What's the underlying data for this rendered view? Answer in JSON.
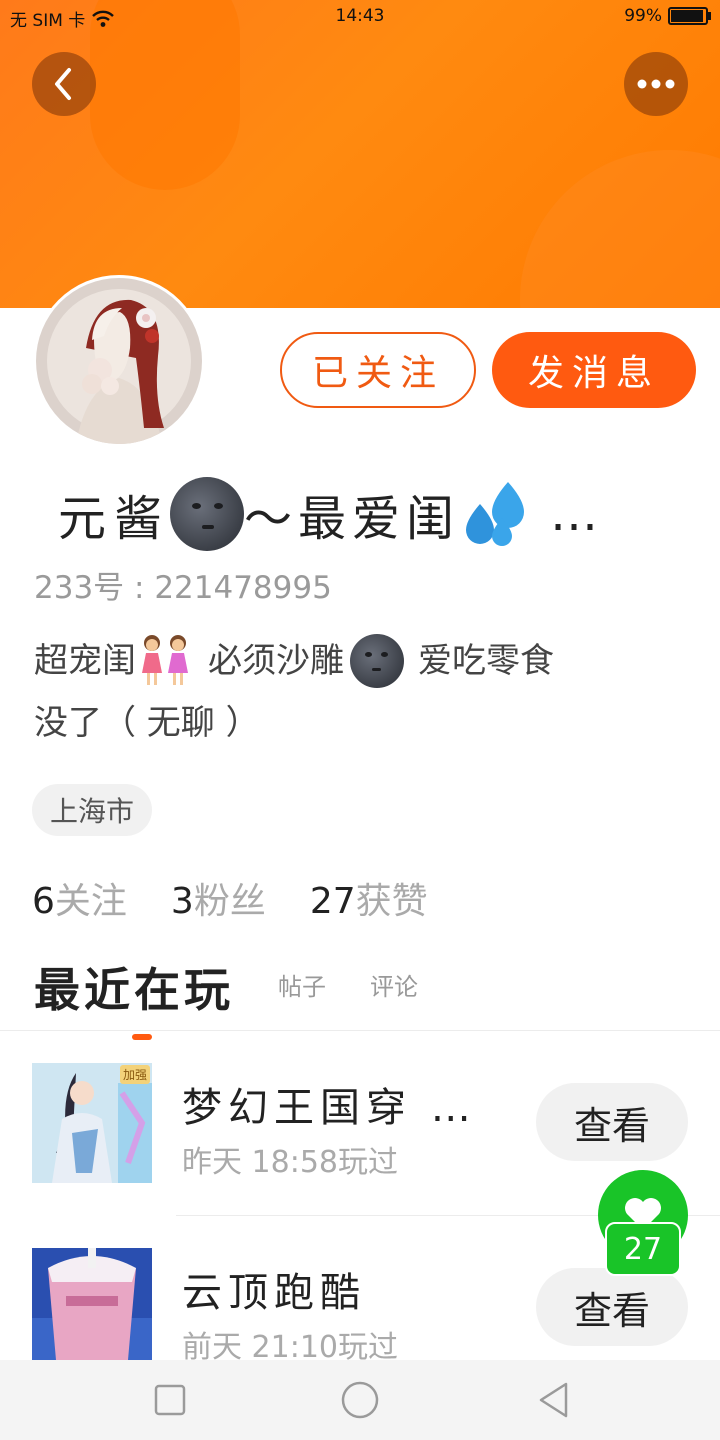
{
  "status_bar": {
    "carrier": "无 SIM 卡",
    "time": "14:43",
    "battery": "99%",
    "battery_level": 0.99
  },
  "header": {
    "back_icon": "chevron-left-icon",
    "more_icon": "more-horizontal-icon",
    "banner_color": "#ff7f12"
  },
  "profile": {
    "follow_button": "已关注",
    "message_button": "发消息",
    "name_prefix": "元酱",
    "name_middle": "～最爱闺",
    "name_suffix": "…",
    "uid": "233号 : 221478995",
    "bio_part1": "超宠闺",
    "bio_part2": " 必须沙雕",
    "bio_part3": " 爱吃零食",
    "bio_line2": "没了（ 无聊 ）",
    "location": "上海市",
    "stats": [
      {
        "count": "6",
        "label": "关注"
      },
      {
        "count": "3",
        "label": "粉丝"
      },
      {
        "count": "27",
        "label": "获赞"
      }
    ]
  },
  "tabs": {
    "active": "最近在玩",
    "posts": "帖子",
    "comments": "评论"
  },
  "games": [
    {
      "title": "梦幻王国穿 …",
      "played": "昨天 18:58玩过",
      "badge": "加强",
      "action": "查看"
    },
    {
      "title": "云顶跑酷",
      "played": "前天 21:10玩过",
      "action": "查看"
    }
  ],
  "like": {
    "count": "27",
    "color": "#19c428"
  },
  "colors": {
    "accent": "#ff5a10"
  }
}
